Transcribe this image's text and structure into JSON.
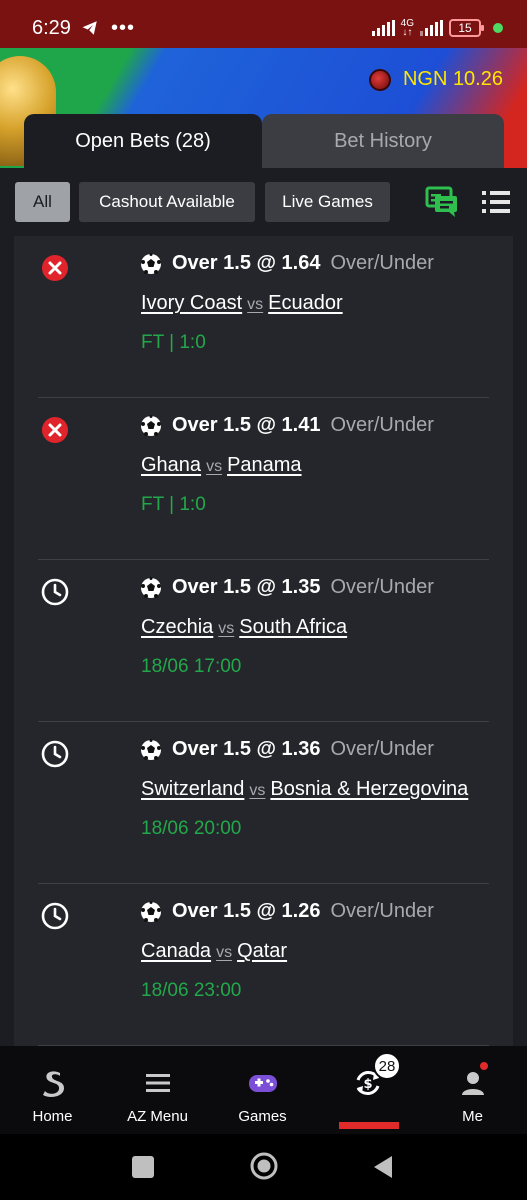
{
  "status_bar": {
    "time": "6:29",
    "net": "4G",
    "battery": "15"
  },
  "header": {
    "balance": "NGN 10.26"
  },
  "tabs": [
    {
      "label": "Open Bets (28)",
      "active": true
    },
    {
      "label": "Bet History",
      "active": false
    }
  ],
  "filters": [
    {
      "label": "All",
      "active": true
    },
    {
      "label": "Cashout Available",
      "active": false
    },
    {
      "label": "Live Games",
      "active": false
    }
  ],
  "bets": [
    {
      "status": "lost",
      "pick": "Over 1.5 @ 1.64",
      "market": "Over/Under",
      "home": "Ivory Coast",
      "vs": "vs",
      "away": "Ecuador",
      "info": "FT | 1:0"
    },
    {
      "status": "lost",
      "pick": "Over 1.5 @ 1.41",
      "market": "Over/Under",
      "home": "Ghana",
      "vs": "vs",
      "away": "Panama",
      "info": "FT | 1:0"
    },
    {
      "status": "pending",
      "pick": "Over 1.5 @ 1.35",
      "market": "Over/Under",
      "home": "Czechia",
      "vs": "vs",
      "away": "South Africa",
      "info": "18/06 17:00"
    },
    {
      "status": "pending",
      "pick": "Over 1.5 @ 1.36",
      "market": "Over/Under",
      "home": "Switzerland",
      "vs": "vs",
      "away": "Bosnia & Herzegovina",
      "info": "18/06 20:00"
    },
    {
      "status": "pending",
      "pick": "Over 1.5 @ 1.26",
      "market": "Over/Under",
      "home": "Canada",
      "vs": "vs",
      "away": "Qatar",
      "info": "18/06 23:00"
    }
  ],
  "bottom_nav": [
    {
      "label": "Home",
      "icon": "sporty-logo-icon"
    },
    {
      "label": "AZ Menu",
      "icon": "menu-icon"
    },
    {
      "label": "Games",
      "icon": "gamepad-icon"
    },
    {
      "label": "",
      "icon": "open-bets-icon",
      "badge": "28",
      "active": true
    },
    {
      "label": "Me",
      "icon": "user-icon"
    }
  ],
  "colors": {
    "status_bar": "#7a1212",
    "accent_red": "#e12b2b",
    "accent_green": "#22a84a",
    "balance_yellow": "#ffe600",
    "list_bg": "#24262b"
  }
}
